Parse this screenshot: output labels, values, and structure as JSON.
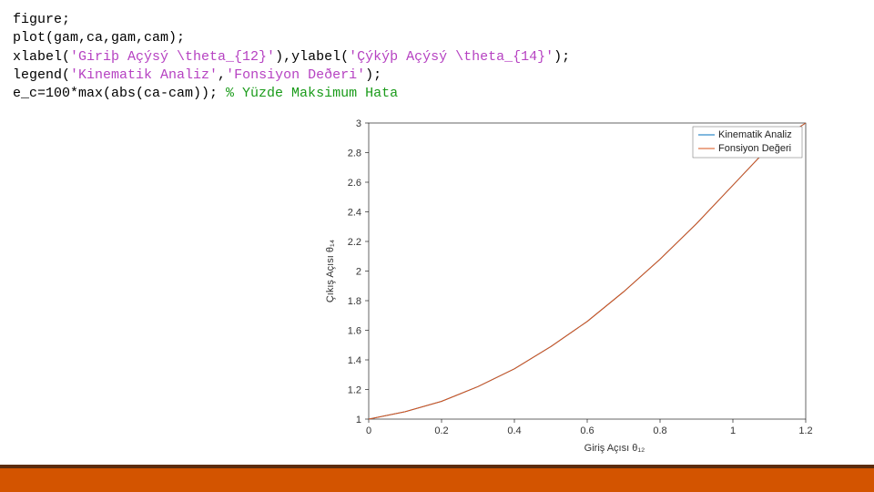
{
  "code": {
    "l1": "figure;",
    "l2a": "plot(gam,ca,gam,cam);",
    "l3a": "xlabel(",
    "l3b": "'Giriþ Açýsý \\theta_{12}'",
    "l3c": "),ylabel(",
    "l3d": "'Çýkýþ Açýsý \\theta_{14}'",
    "l3e": ");",
    "l4a": "legend(",
    "l4b": "'Kinematik Analiz'",
    "l4c": ",",
    "l4d": "'Fonsiyon Deðeri'",
    "l4e": ");",
    "l5a": "e_c=100*max(abs(ca-cam)); ",
    "l5b": "% Yüzde Maksimum Hata"
  },
  "chart_data": {
    "type": "line",
    "title": "",
    "xlabel": "Giriş Açısı θ₁₂",
    "ylabel": "Çıkış Açısı θ₁₄",
    "xlim": [
      0,
      1.2
    ],
    "ylim": [
      1,
      3
    ],
    "x_ticks": [
      0,
      0.2,
      0.4,
      0.6,
      0.8,
      1,
      1.2
    ],
    "y_ticks": [
      1,
      1.2,
      1.4,
      1.6,
      1.8,
      2,
      2.2,
      2.4,
      2.6,
      2.8,
      3
    ],
    "legend": [
      "Kinematik Analiz",
      "Fonsiyon Değeri"
    ],
    "legend_position": "top-right",
    "series": [
      {
        "name": "Kinematik Analiz",
        "color": "#0072bd",
        "x": [
          0,
          0.1,
          0.2,
          0.3,
          0.4,
          0.5,
          0.6,
          0.7,
          0.8,
          0.9,
          1.0,
          1.1,
          1.2
        ],
        "y": [
          1.0,
          1.05,
          1.12,
          1.22,
          1.34,
          1.49,
          1.66,
          1.86,
          2.08,
          2.32,
          2.58,
          2.84,
          3.0
        ]
      },
      {
        "name": "Fonsiyon Değeri",
        "color": "#d95319",
        "x": [
          0,
          0.1,
          0.2,
          0.3,
          0.4,
          0.5,
          0.6,
          0.7,
          0.8,
          0.9,
          1.0,
          1.1,
          1.2
        ],
        "y": [
          1.0,
          1.05,
          1.12,
          1.22,
          1.34,
          1.49,
          1.66,
          1.86,
          2.08,
          2.32,
          2.58,
          2.84,
          3.0
        ]
      }
    ]
  }
}
